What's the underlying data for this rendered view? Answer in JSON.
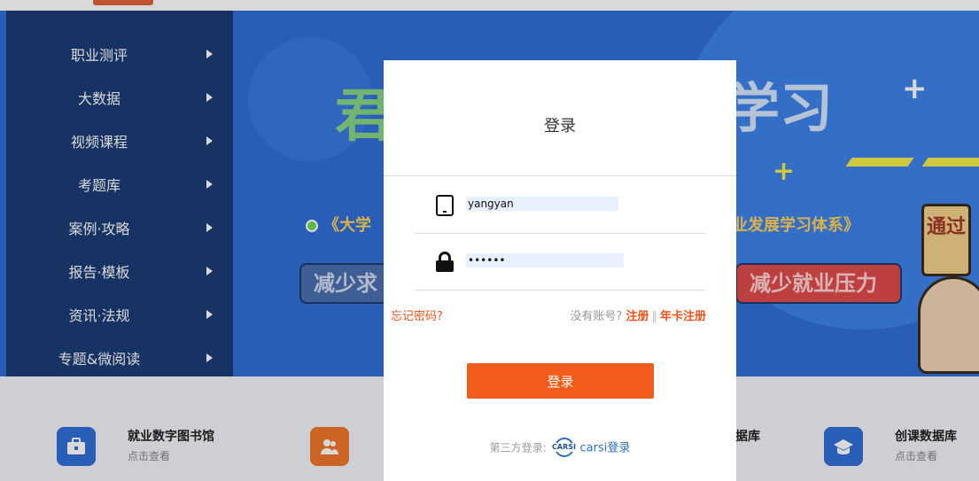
{
  "nav": {
    "items": [
      {
        "label": "职业测评"
      },
      {
        "label": "大数据"
      },
      {
        "label": "视频课程"
      },
      {
        "label": "考题库"
      },
      {
        "label": "案例·攻略"
      },
      {
        "label": "报告·模板"
      },
      {
        "label": "资讯·法规"
      },
      {
        "label": "专题&微阅读"
      }
    ]
  },
  "banner": {
    "slogan_left": "《大学",
    "slogan_right": "业发展学习体系》",
    "pill_left": "减少求",
    "pill_right": "减少就业压力",
    "badge": "通过"
  },
  "cards": [
    {
      "title": "就业数字图书馆",
      "sub": "点击查看",
      "icon": "briefcase-icon",
      "color": "#2f6fd8"
    },
    {
      "title": "",
      "sub": "",
      "icon": "people-icon",
      "color": "#f0772a"
    },
    {
      "title": "据库",
      "sub": "",
      "icon": "",
      "color": ""
    },
    {
      "title": "创课数据库",
      "sub": "点击查看",
      "icon": "graduation-cap-icon",
      "color": "#2f6fd8"
    }
  ],
  "modal": {
    "title": "登录",
    "username_value": "yangyan",
    "password_value": "••••••",
    "forgot": "忘记密码?",
    "no_account": "没有账号?",
    "register": "注册",
    "separator": "‖",
    "annual_register": "年卡注册",
    "login_button": "登录",
    "third_party_label": "第三方登录:",
    "carsi_logo_text": "CARSI",
    "carsi_login": "carsi登录"
  }
}
